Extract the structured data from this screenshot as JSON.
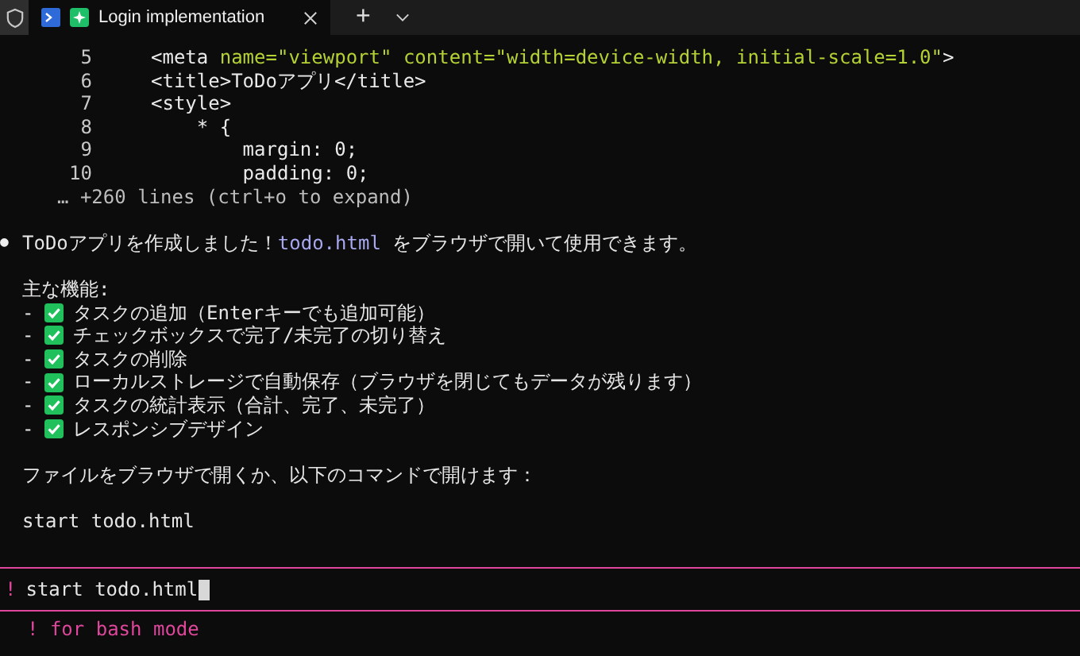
{
  "tab_bar": {
    "tabs": [
      {
        "title": "Login implementation",
        "selected": true
      }
    ],
    "new_tab": "+"
  },
  "code_lines": [
    {
      "number": "5",
      "segments": [
        {
          "kind": "tag",
          "text": "<meta "
        },
        {
          "kind": "attr",
          "text": "name=\"viewport\" content="
        },
        {
          "kind": "attr",
          "text": "\"width=device-width, initial-scale=1.0\""
        },
        {
          "kind": "tag",
          "text": ">"
        }
      ]
    },
    {
      "number": "6",
      "segments": [
        {
          "kind": "tag",
          "text": "<title>ToDoアプリ</title>"
        }
      ]
    },
    {
      "number": "7",
      "segments": [
        {
          "kind": "tag",
          "text": "<style>"
        }
      ]
    },
    {
      "number": "8",
      "segments": [
        {
          "kind": "tag",
          "text": "    * {"
        }
      ]
    },
    {
      "number": "9",
      "segments": [
        {
          "kind": "tag",
          "text": "        margin: 0;"
        }
      ]
    },
    {
      "number": "10",
      "segments": [
        {
          "kind": "tag",
          "text": "        padding: 0;"
        }
      ]
    }
  ],
  "collapsed_note": "… +260 lines (ctrl+o to expand)",
  "message": {
    "bullet": "●",
    "before": "ToDoアプリを作成しました！",
    "filename": "todo.html",
    "after": " をブラウザで開いて使用できます。"
  },
  "features_heading": "主な機能:",
  "features": [
    {
      "dash": "-",
      "text": "タスクの追加（Enterキーでも追加可能）"
    },
    {
      "dash": "-",
      "text": "チェックボックスで完了/未完了の切り替え"
    },
    {
      "dash": "-",
      "text": "タスクの削除"
    },
    {
      "dash": "-",
      "text": "ローカルストレージで自動保存（ブラウザを閉じてもデータが残ります）"
    },
    {
      "dash": "-",
      "text": "タスクの統計表示（合計、完了、未完了）"
    },
    {
      "dash": "-",
      "text": "レスポンシブデザイン"
    }
  ],
  "instruction": "ファイルをブラウザで開くか、以下のコマンドで開けます：",
  "command": "start todo.html",
  "input": {
    "prompt": "!",
    "value": "start todo.html"
  },
  "hint": "! for bash mode"
}
